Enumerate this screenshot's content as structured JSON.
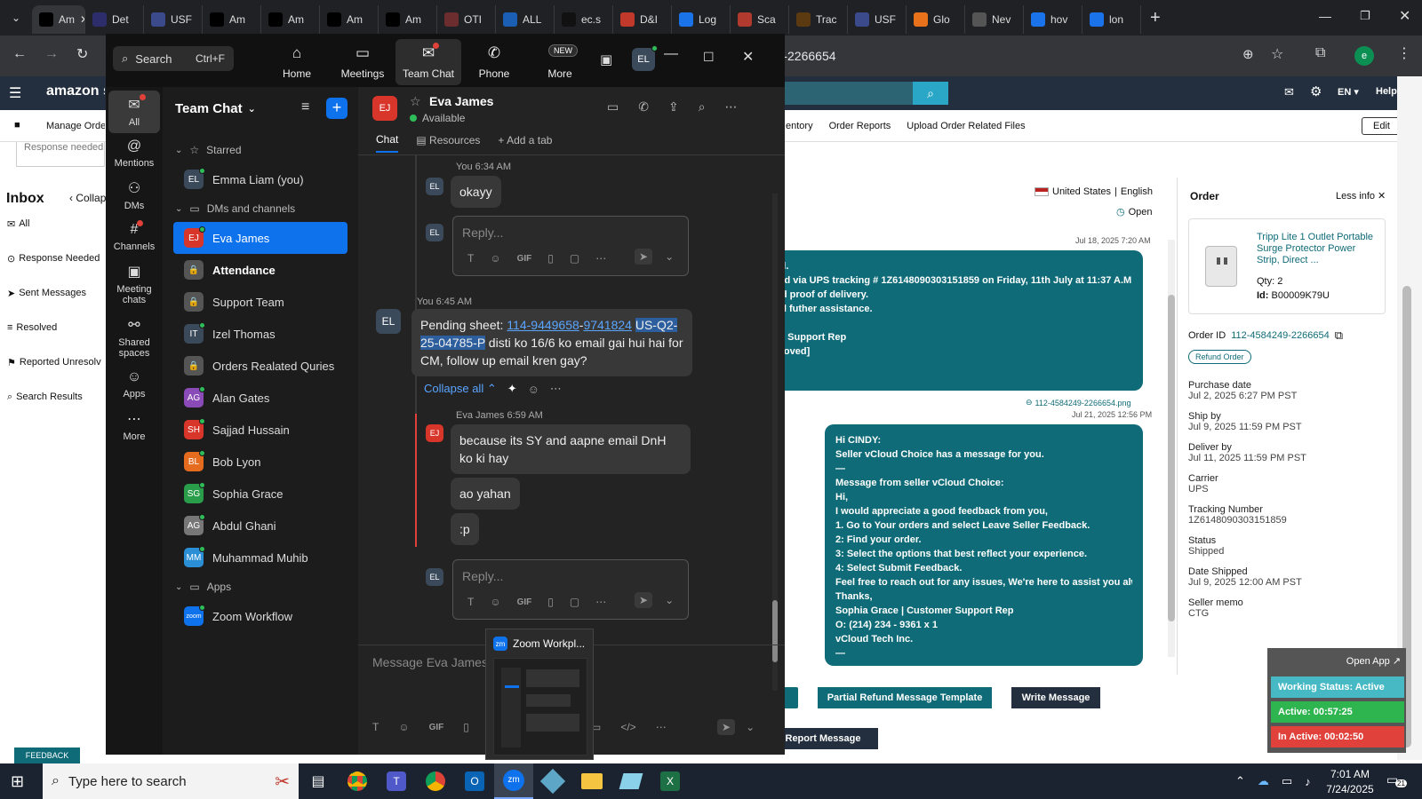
{
  "browser": {
    "tabs": [
      "Am",
      "Det",
      "USF",
      "Am",
      "Am",
      "Am",
      "Am",
      "OTI",
      "ALL",
      "ec.s",
      "D&I",
      "Log",
      "Sca",
      "Trac",
      "USF",
      "Glo",
      "Nev",
      "hov",
      "lon"
    ],
    "url": "249-2266654",
    "profile_initial": "e"
  },
  "amazon": {
    "logo": "amazon sel",
    "menu": {
      "lang": "EN",
      "help": "Help"
    },
    "nav": {
      "manage_orders": "Manage Order",
      "inventory": "entory",
      "order_reports": "Order Reports",
      "upload": "Upload Order Related Files",
      "edit": "Edit"
    },
    "response_needed_box": "Response needed",
    "inbox": {
      "title": "Inbox",
      "collapse": "Collap",
      "items": [
        "All",
        "Response Needed",
        "Sent Messages",
        "Resolved",
        "Reported Unresolv",
        "Search Results"
      ]
    },
    "locale": {
      "country": "United States",
      "sep": "|",
      "language": "English"
    },
    "status_open": "Open",
    "msg1_time": "Jul 18, 2025 7:20 AM",
    "msg1_lines": [
      "vell.",
      "ered via UPS tracking # 1Z6148090303151859 on Friday, 11th July at 11:37 A.M.",
      "hed proof of delivery.",
      "eed futher assistance.",
      "",
      "her Support Rep",
      "emoved]",
      "1"
    ],
    "attachment": "112-4584249-2266654.png",
    "msg2_time": "Jul 21, 2025 12:56 PM",
    "msg2_lines": [
      "Hi CINDY:",
      "Seller vCloud Choice has a message for you.",
      "—",
      "Message from seller vCloud Choice:",
      "Hi,",
      "I would appreciate a good feedback from you,",
      "1. Go to Your orders and select Leave Seller Feedback.",
      "2: Find your order.",
      "3: Select the options that best reflect your experience.",
      "4: Select Submit Feedback.",
      "Feel free to reach out for any issues, We're here to assist you always.",
      "Thanks,",
      "Sophia Grace | Customer Support Rep",
      "O: (214) 234 - 9361 x 1",
      "vCloud Tech Inc.",
      "—"
    ],
    "buttons": {
      "partial": "e",
      "partial_refund": "Partial Refund Message Template",
      "write": "Write Message",
      "report": "Report Message"
    },
    "feedback": "FEEDBACK",
    "order": {
      "header": "Order",
      "less_info": "Less info",
      "product_title": "Tripp Lite 1 Outlet Portable Surge Protector Power Strip, Direct ...",
      "qty_label": "Qty:",
      "qty": "2",
      "id_label": "Id:",
      "asin": "B00009K79U",
      "order_id_label": "Order ID",
      "order_id": "112-4584249-2266654",
      "refund_btn": "Refund Order",
      "fields": [
        {
          "label": "Purchase date",
          "value": "Jul 2, 2025 6:27 PM PST"
        },
        {
          "label": "Ship by",
          "value": "Jul 9, 2025 11:59 PM PST"
        },
        {
          "label": "Deliver by",
          "value": "Jul 11, 2025 11:59 PM PST"
        },
        {
          "label": "Carrier",
          "value": "UPS"
        },
        {
          "label": "Tracking Number",
          "value": "1Z6148090303151859"
        },
        {
          "label": "Status",
          "value": "Shipped"
        },
        {
          "label": "Date Shipped",
          "value": "Jul 9, 2025 12:00 AM PST"
        },
        {
          "label": "Seller memo",
          "value": "CTG"
        }
      ]
    },
    "widget": {
      "open_app": "Open App ↗",
      "working": "Working Status: Active",
      "active": "Active: 00:57:25",
      "inactive": "In Active: 00:02:50"
    }
  },
  "zoom": {
    "search": {
      "label": "Search",
      "shortcut": "Ctrl+F"
    },
    "tabs": [
      "Home",
      "Meetings",
      "Team Chat",
      "Phone",
      "More"
    ],
    "new_badge": "NEW",
    "user_initials": "EL",
    "rail": [
      "All",
      "Mentions",
      "DMs",
      "Channels",
      "Meeting chats",
      "Shared spaces",
      "Apps",
      "More"
    ],
    "list_title": "Team Chat",
    "starred": "Starred",
    "starred_items": [
      {
        "initials": "EL",
        "name": "Emma Liam (you)",
        "color": "#3b4a5a"
      }
    ],
    "dms_header": "DMs and channels",
    "dms": [
      {
        "initials": "EJ",
        "name": "Eva James",
        "color": "#d9362b",
        "sel": true
      },
      {
        "initials": "🔒",
        "name": "Attendance",
        "color": "#555",
        "bold": true
      },
      {
        "initials": "🔒",
        "name": "Support Team",
        "color": "#555"
      },
      {
        "initials": "IT",
        "name": "Izel Thomas",
        "color": "#3b4a5a"
      },
      {
        "initials": "🔒",
        "name": "Orders Realated Quries",
        "color": "#555"
      },
      {
        "initials": "AG",
        "name": "Alan Gates",
        "color": "#8a4bb8"
      },
      {
        "initials": "SH",
        "name": "Sajjad Hussain",
        "color": "#d9362b"
      },
      {
        "initials": "BL",
        "name": "Bob Lyon",
        "color": "#e56b1f"
      },
      {
        "initials": "SG",
        "name": "Sophia Grace",
        "color": "#2a9d4a"
      },
      {
        "initials": "AG",
        "name": "Abdul Ghani",
        "color": "#777"
      },
      {
        "initials": "MM",
        "name": "Muhammad Muhib",
        "color": "#2b8fd6"
      }
    ],
    "apps_header": "Apps",
    "apps": [
      {
        "initials": "zoom",
        "name": "Zoom Workflow",
        "color": "#0e72ed"
      }
    ],
    "chat": {
      "name": "Eva James",
      "initials": "EJ",
      "status": "Available",
      "subtabs": [
        "Chat",
        "Resources",
        "Add a tab"
      ],
      "m1_time": "You 6:34 AM",
      "m1": "okayy",
      "reply_placeholder": "Reply...",
      "m2_time": "You 6:45 AM",
      "m2_pre": "Pending sheet: ",
      "m2_link1": "114-9449658",
      "m2_dash": "-",
      "m2_link2": "9741824",
      "m2_sp": " ",
      "m2_hl": "US-Q2-25-04785-P",
      "m2_post": " disti ko 16/6 ko email gai hui hai for CM, follow up email kren gay?",
      "collapse_all": "Collapse all",
      "r_time": "Eva James 6:59 AM",
      "r1": "because its SY and aapne email DnH ko ki hay",
      "r2": "ao yahan",
      "r3": ":p",
      "composer_placeholder": "Message Eva James",
      "gif": "GIF"
    },
    "preview_title": "Zoom Workpl..."
  },
  "taskbar": {
    "search_placeholder": "Type here to search",
    "time": "7:01 AM",
    "date": "7/24/2025",
    "notif_count": "21"
  }
}
